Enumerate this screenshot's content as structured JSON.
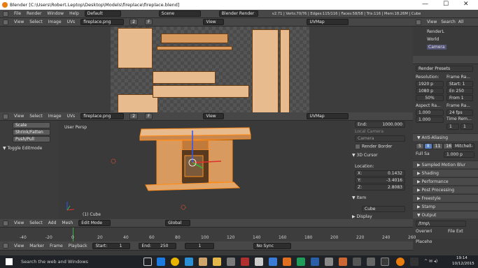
{
  "window": {
    "title": "Blender [C:\\Users\\Robert.Leptop\\Desktop\\Models\\fireplace\\fireplace.blend]",
    "minimize": "—",
    "maximize": "☐",
    "close": "✕"
  },
  "info_header": {
    "menus": [
      "File",
      "Render",
      "Window",
      "Help"
    ],
    "layout": "Default",
    "scene": "Scene",
    "engine": "Blender Render",
    "stats": "v2.71 | Verts:70/76 | Edges:115/116 | Faces:58/58 | Tris:116 | Mem:18.26M | Cube"
  },
  "uv_editor_top": {
    "menus": [
      "View",
      "Select",
      "Image",
      "UVs"
    ],
    "image": "fireplace.png",
    "users": "2",
    "f": "F",
    "view": "View",
    "uvmap": "UVMap"
  },
  "uv_editor_bottom": {
    "menus": [
      "View",
      "Select",
      "Image",
      "UVs"
    ],
    "image": "fireplace.png",
    "users": "2",
    "f": "F",
    "view": "View",
    "uvmap": "UVMap"
  },
  "tool_shelf": {
    "buttons": [
      "Scale",
      "Shrink/Fatten",
      "Push/Pull"
    ],
    "section": "Toggle Editmode"
  },
  "viewport": {
    "label": "User Persp",
    "object_label": "(1) Cube",
    "menus": [
      "View",
      "Select",
      "Add",
      "Mesh"
    ],
    "mode": "Edit Mode",
    "pivot": "Global"
  },
  "n_panel": {
    "end_label": "End:",
    "end_value": "1000.000",
    "local_camera": "Local Camera",
    "camera": "Camera",
    "render_border": "Render Border",
    "cursor_section": "3D Cursor",
    "location_label": "Location:",
    "x_label": "X:",
    "x": "0.1432",
    "y_label": "Y:",
    "y": "-3.4016",
    "z_label": "Z:",
    "z": "2.8083",
    "item_section": "Item",
    "item_name": "Cube",
    "display_section": "Display"
  },
  "outliner": {
    "menus": [
      "View",
      "Search",
      "All"
    ],
    "items": [
      "RenderL",
      "World",
      "Camera"
    ]
  },
  "properties": {
    "render_presets": "Render Presets",
    "resolution_label": "Resolution:",
    "frame_range_label": "Frame Ra...",
    "res_x": "1920 p",
    "res_y": "1080 p",
    "res_pct": "50%",
    "start": "Start: 1",
    "end": "En 250",
    "frame": "From 1",
    "aspect_label": "Aspect Ra...",
    "frame_rate_label": "Frame Ra...",
    "aspect_x": "1.000",
    "aspect_y": "1.000",
    "fps": "24 fps",
    "time_rem": "Time Rem...",
    "time_a": "1",
    "time_b": "1",
    "anti_aliasing": "Anti-Aliasing",
    "aa_samples": [
      "5",
      "8",
      "11",
      "16"
    ],
    "aa_filter": "Mitchell-",
    "full_sample": "Full Sa",
    "filter_size": "1.000 p",
    "sampled_motion_blur": "Sampled Motion Blur",
    "shading": "Shading",
    "performance": "Performance",
    "post_processing": "Post Processing",
    "freestyle": "Freestyle",
    "stamp": "Stamp",
    "output": "Output",
    "output_path": "/tmp\\",
    "overwrite": "Overwri",
    "file_ext": "File Ext",
    "placeholders": "Placeho"
  },
  "timeline": {
    "ruler": [
      "-40",
      "-20",
      "0",
      "20",
      "40",
      "60",
      "80",
      "100",
      "120",
      "140",
      "160",
      "180",
      "200",
      "220",
      "240",
      "260"
    ],
    "menus": [
      "View",
      "Marker",
      "Frame",
      "Playback"
    ],
    "start": "Start:",
    "start_value": "1",
    "end": "End:",
    "end_value": "250",
    "current": "1",
    "sync": "No Sync"
  },
  "taskbar": {
    "search": "Search the web and Windows",
    "time": "19:14",
    "date": "10/12/2015"
  },
  "colors": {
    "wood": "#e8bb8e",
    "wood_dark": "#d89a5e",
    "selection": "#ff8c1a",
    "ui_bg": "#393939",
    "header": "#474747"
  }
}
